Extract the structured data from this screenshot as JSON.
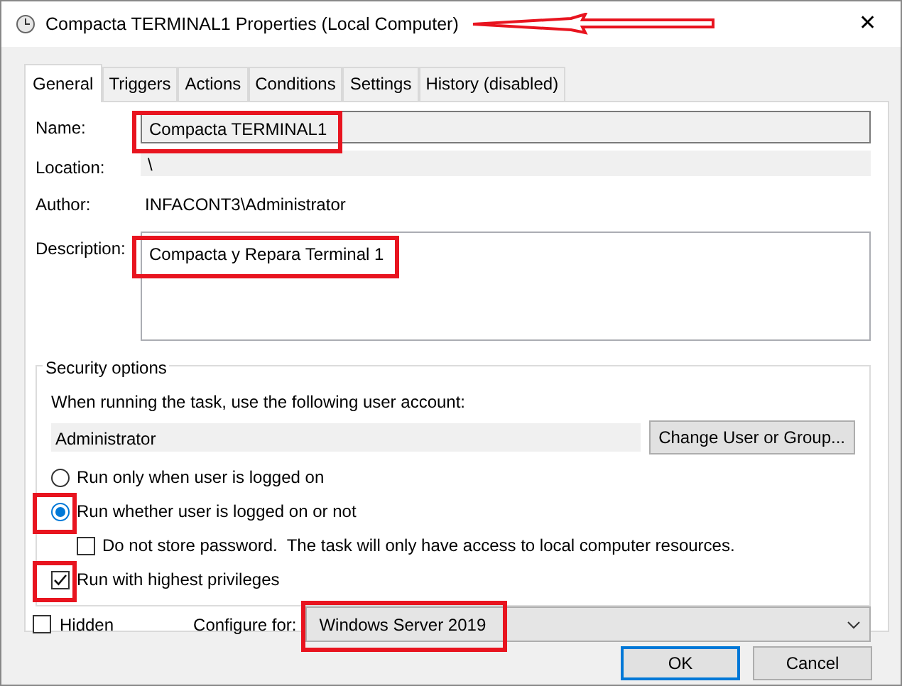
{
  "window": {
    "title": "Compacta TERMINAL1 Properties (Local Computer)",
    "close_label": "✕"
  },
  "annotation_arrow": true,
  "tabs": [
    {
      "label": "General",
      "selected": true
    },
    {
      "label": "Triggers",
      "selected": false
    },
    {
      "label": "Actions",
      "selected": false
    },
    {
      "label": "Conditions",
      "selected": false
    },
    {
      "label": "Settings",
      "selected": false
    },
    {
      "label": "History (disabled)",
      "selected": false
    }
  ],
  "fields": [
    {
      "kind": "input",
      "label": "Name:",
      "value": "Compacta TERMINAL1",
      "highlighted": true
    },
    {
      "kind": "readonly",
      "label": "Location:",
      "value": "\\",
      "highlighted": false
    },
    {
      "kind": "text",
      "label": "Author:",
      "value": "INFACONT3\\Administrator",
      "highlighted": false
    },
    {
      "kind": "textarea",
      "label": "Description:",
      "value": "Compacta y Repara Terminal 1",
      "highlighted": true
    }
  ],
  "security": {
    "title": "Security options",
    "account_prompt": "When running the task, use the following user account:",
    "account": "Administrator",
    "change_button": "Change User or Group...",
    "options": [
      {
        "kind": "radio",
        "label": "Run only when user is logged on",
        "selected": false,
        "indented": false,
        "highlighted": false
      },
      {
        "kind": "radio",
        "label": "Run whether user is logged on or not",
        "selected": true,
        "indented": false,
        "highlighted": true
      },
      {
        "kind": "checkbox",
        "label": "Do not store password.  The task will only have access to local computer resources.",
        "checked": false,
        "indented": true,
        "highlighted": false
      },
      {
        "kind": "checkbox",
        "label": "Run with highest privileges",
        "checked": true,
        "indented": false,
        "highlighted": true
      }
    ]
  },
  "hidden": {
    "label": "Hidden",
    "checked": false
  },
  "configure": {
    "label": "Configure for:",
    "value": "Windows Server 2019",
    "highlighted": true
  },
  "buttons": [
    {
      "label": "OK",
      "default": true
    },
    {
      "label": "Cancel",
      "default": false
    }
  ]
}
